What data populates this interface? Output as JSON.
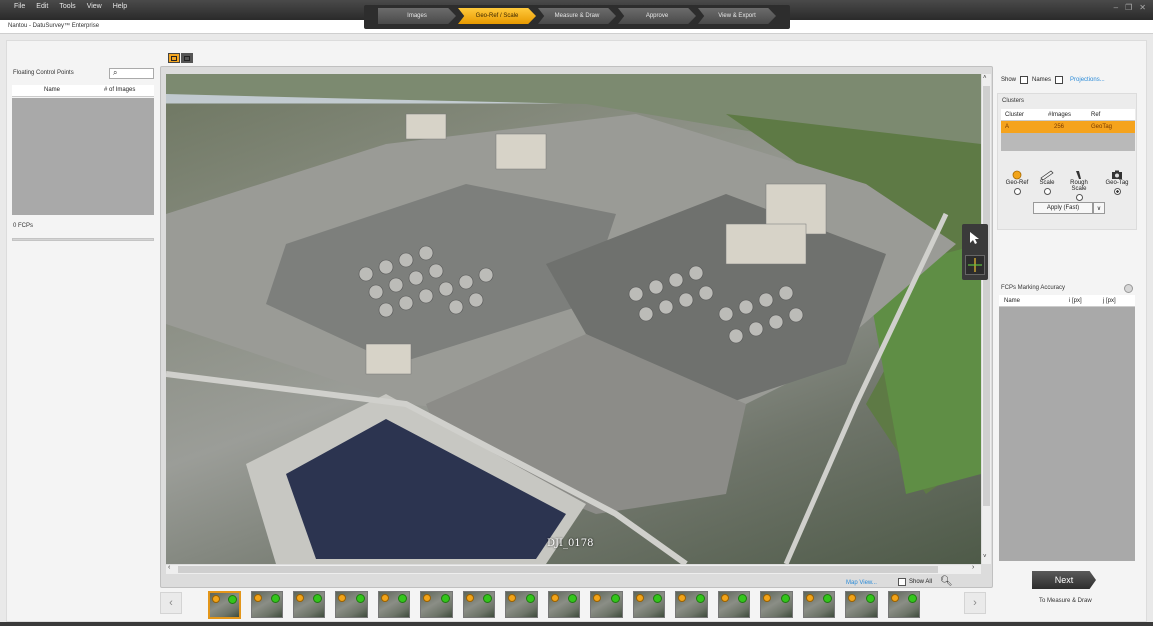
{
  "menu": [
    "File",
    "Edit",
    "Tools",
    "View",
    "Help"
  ],
  "app_title": "Nantou - DatuSurvey™ Enterprise",
  "wizard_steps": [
    {
      "label": "Images",
      "active": false
    },
    {
      "label": "Geo-Ref / Scale",
      "active": true
    },
    {
      "label": "Measure & Draw",
      "active": false
    },
    {
      "label": "Approve",
      "active": false
    },
    {
      "label": "View & Export",
      "active": false
    }
  ],
  "window_controls": [
    "–",
    "❐",
    "✕"
  ],
  "left_panel": {
    "title": "Floating Control Points",
    "columns": [
      "Name",
      "# of Images"
    ],
    "count_label": "0 FCPs"
  },
  "viewer": {
    "image_name": "DJI_0178",
    "map_view_link": "Map View...",
    "show_all_label": "Show All",
    "zoom_icon": "zoom-in-icon"
  },
  "filmstrip": {
    "thumbnail_count": 17,
    "selected_index": 0
  },
  "right_panel": {
    "show_label": "Show",
    "names_label": "Names",
    "projections_link": "Projections...",
    "clusters": {
      "title": "Clusters",
      "columns": [
        "Cluster",
        "#Images",
        "Ref"
      ],
      "rows": [
        {
          "cluster": "A",
          "images": "256",
          "ref": "GeoTag"
        }
      ]
    },
    "ref_tools": [
      {
        "label": "Geo-Ref",
        "icon": "geo-ref-icon",
        "selected": false
      },
      {
        "label": "Scale",
        "icon": "ruler-icon",
        "selected": false
      },
      {
        "label": "Rough Scale",
        "icon": "rough-scale-icon",
        "selected": false
      },
      {
        "label": "Geo-Tag",
        "icon": "camera-icon",
        "selected": true
      }
    ],
    "apply_label": "Apply (Fast)",
    "accuracy": {
      "title": "FCPs Marking Accuracy",
      "columns": [
        "Name",
        "i [px]",
        "j [px]"
      ]
    },
    "next_label": "Next",
    "next_sub": "To Measure & Draw"
  },
  "colors": {
    "accent": "#f5a31d",
    "link": "#2a8bd8",
    "ok": "#34c51c"
  }
}
